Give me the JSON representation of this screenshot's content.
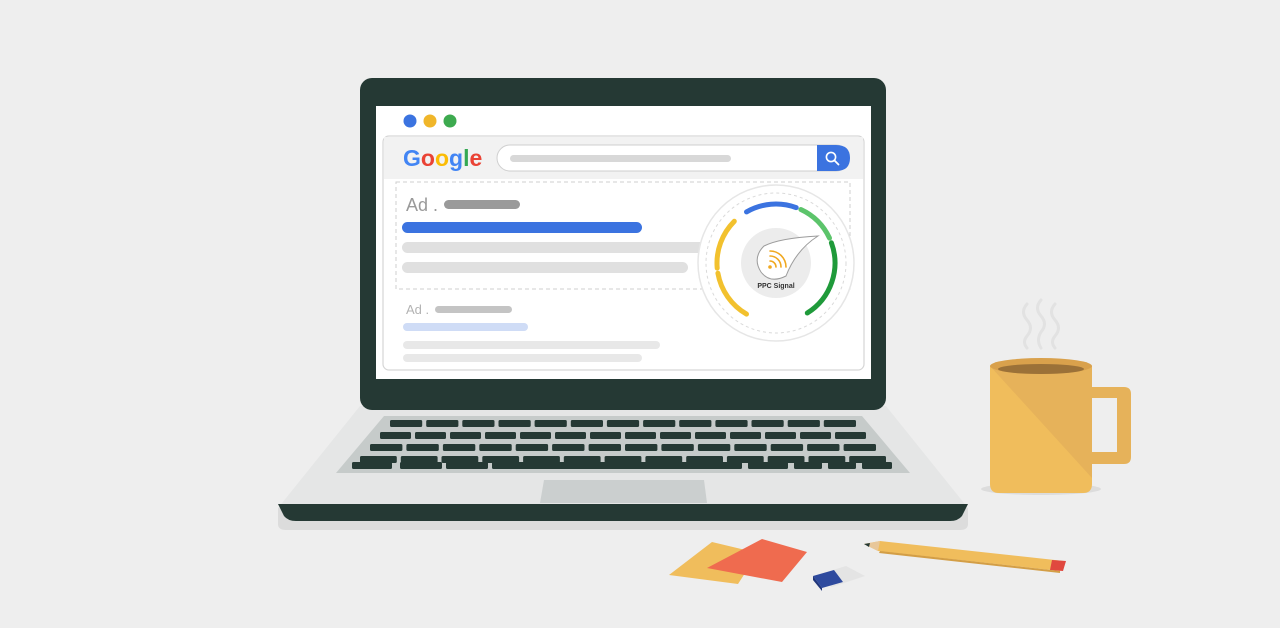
{
  "browser": {
    "logo_letters": [
      {
        "char": "G",
        "color": "#4285F4"
      },
      {
        "char": "o",
        "color": "#EA4335"
      },
      {
        "char": "o",
        "color": "#FBBC05"
      },
      {
        "char": "g",
        "color": "#4285F4"
      },
      {
        "char": "l",
        "color": "#34A853"
      },
      {
        "char": "e",
        "color": "#EA4335"
      }
    ],
    "window_dot_colors": [
      "#3b73e0",
      "#f0b62a",
      "#3daa4f"
    ],
    "search_icon": "search-icon"
  },
  "results": {
    "ad1_label": "Ad .",
    "ad2_label": "Ad ."
  },
  "gauge": {
    "label": "PPC Signal",
    "icon": "rss-signal-icon",
    "segment_colors": [
      "#f2c12e",
      "#3b73e0",
      "#5cc46b",
      "#1f9a3a"
    ]
  },
  "colors": {
    "background": "#eeeeee",
    "laptop_frame": "#253934",
    "accent_blue": "#3b73e0",
    "mug": "#f0bd5c",
    "pencil": "#f0bd5c",
    "sticky_orange": "#ef6b4f"
  }
}
